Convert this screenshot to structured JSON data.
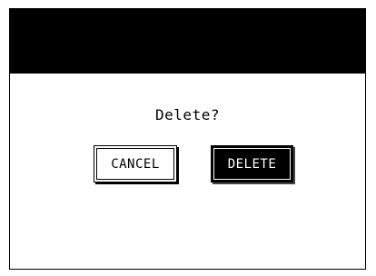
{
  "dialog": {
    "message": "Delete?",
    "buttons": {
      "cancel": "CANCEL",
      "delete": "DELETE"
    }
  },
  "colors": {
    "titlebar": "#000000",
    "background": "#ffffff",
    "primary_button_bg": "#000000",
    "primary_button_text": "#ffffff"
  }
}
